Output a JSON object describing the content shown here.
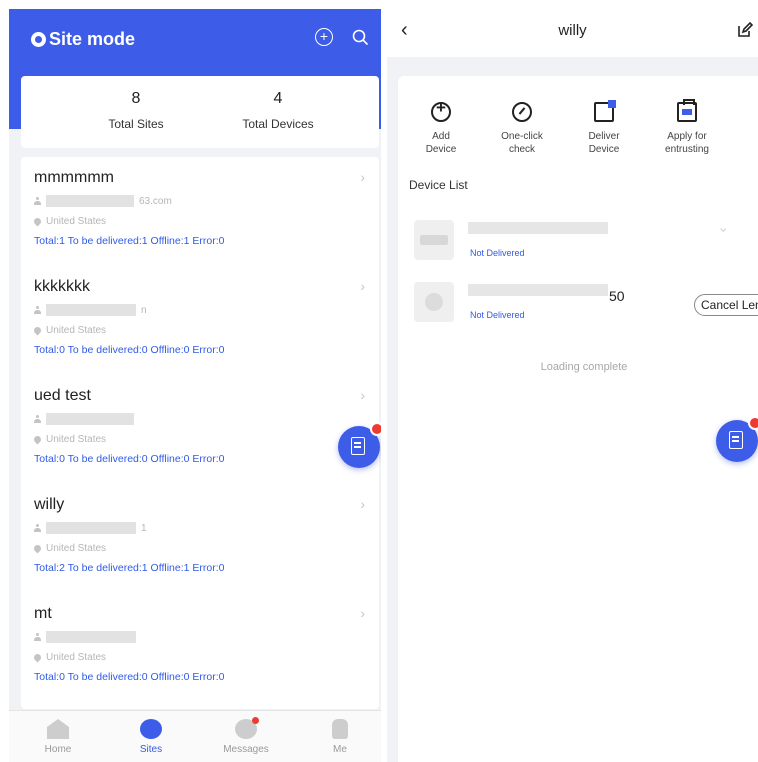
{
  "left": {
    "header": {
      "title": "Site mode"
    },
    "stats": [
      {
        "value": "8",
        "label": "Total Sites"
      },
      {
        "value": "4",
        "label": "Total Devices"
      }
    ],
    "sites": [
      {
        "name": "mmmmmm",
        "user_suffix": "63.com",
        "location": "United States",
        "status": "Total:1  To be delivered:1  Offline:1  Error:0"
      },
      {
        "name": "kkkkkkk",
        "user_suffix": "n",
        "location": "United States",
        "status": "Total:0  To be delivered:0  Offline:0  Error:0"
      },
      {
        "name": "ued test",
        "user_suffix": "",
        "location": "United States",
        "status": "Total:0  To be delivered:0  Offline:0  Error:0"
      },
      {
        "name": "willy",
        "user_suffix": "1",
        "location": "United States",
        "status": "Total:2  To be delivered:1  Offline:1  Error:0"
      },
      {
        "name": "mt",
        "user_suffix": "",
        "location": "United States",
        "status": "Total:0  To be delivered:0  Offline:0  Error:0"
      }
    ],
    "tabs": [
      {
        "label": "Home",
        "icon": "home-icon"
      },
      {
        "label": "Sites",
        "icon": "sites-icon"
      },
      {
        "label": "Messages",
        "icon": "messages-icon"
      },
      {
        "label": "Me",
        "icon": "me-icon"
      }
    ],
    "active_tab": "Sites"
  },
  "right": {
    "title": "willy",
    "actions": [
      {
        "label": "Add\nDevice",
        "icon": "add-circle-icon"
      },
      {
        "label": "One-click\ncheck",
        "icon": "gauge-icon"
      },
      {
        "label": "Deliver\nDevice",
        "icon": "deliver-icon"
      },
      {
        "label": "Apply for\nentrusting",
        "icon": "briefcase-icon"
      }
    ],
    "device_list_title": "Device List",
    "devices": [
      {
        "status": "Not Delivered",
        "suffix": ""
      },
      {
        "status": "Not Delivered",
        "suffix": "50",
        "button": "Cancel Len"
      }
    ],
    "loading_text": "Loading complete"
  },
  "colors": {
    "primary": "#3d5de9",
    "link": "#2f5be6",
    "badge": "#ee3b32"
  }
}
